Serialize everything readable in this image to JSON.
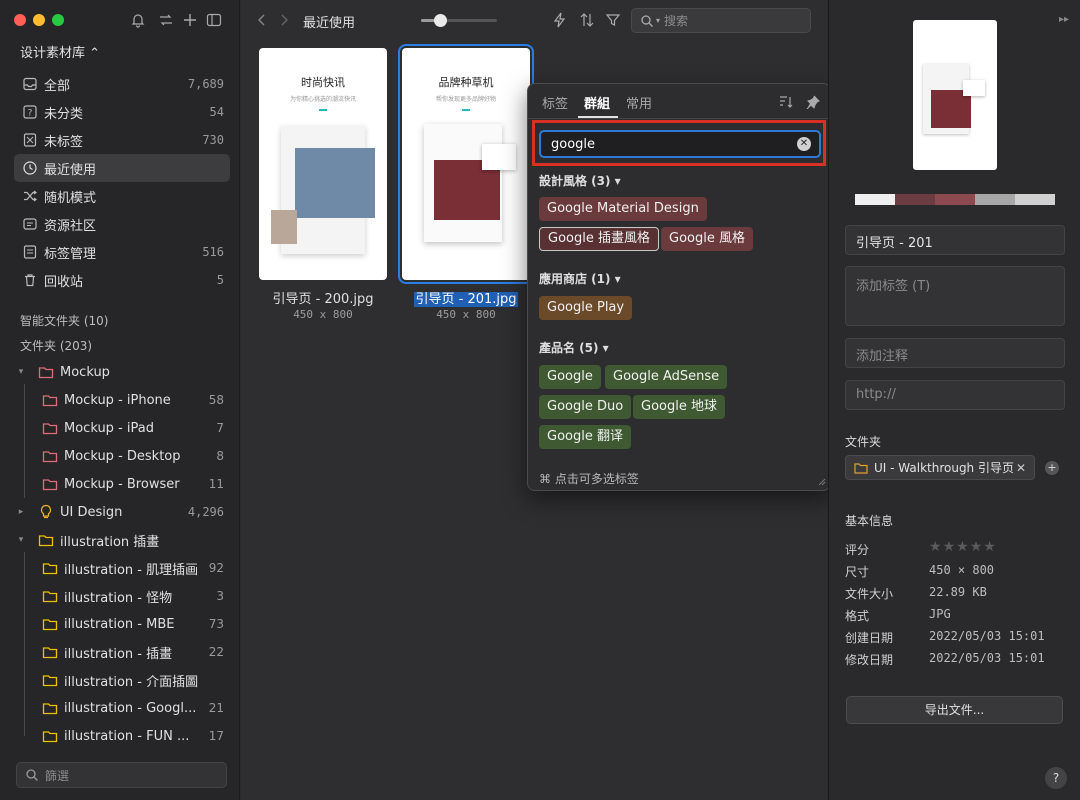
{
  "sidebar": {
    "library_title": "设计素材库 ⌃",
    "items": [
      {
        "label": "全部",
        "count": "7,689"
      },
      {
        "label": "未分类",
        "count": "54"
      },
      {
        "label": "未标签",
        "count": "730"
      },
      {
        "label": "最近使用",
        "count": ""
      },
      {
        "label": "随机模式",
        "count": ""
      },
      {
        "label": "资源社区",
        "count": ""
      },
      {
        "label": "标签管理",
        "count": "516"
      },
      {
        "label": "回收站",
        "count": "5"
      }
    ],
    "smart_folders": "智能文件夹 (10)",
    "folders_header": "文件夹 (203)",
    "folders": [
      {
        "label": "Mockup",
        "count": ""
      },
      {
        "label": "Mockup - iPhone",
        "count": "58"
      },
      {
        "label": "Mockup - iPad",
        "count": "7"
      },
      {
        "label": "Mockup - Desktop",
        "count": "8"
      },
      {
        "label": "Mockup - Browser",
        "count": "11"
      },
      {
        "label": "UI Design",
        "count": "4,296"
      },
      {
        "label": "illustration 插畫",
        "count": ""
      },
      {
        "label": "illustration - 肌理插画",
        "count": "92"
      },
      {
        "label": "illustration - 怪物",
        "count": "3"
      },
      {
        "label": "illustration - MBE",
        "count": "73"
      },
      {
        "label": "illustration - 插畫",
        "count": "22"
      },
      {
        "label": "illustration - 介面插圖",
        "count": ""
      },
      {
        "label": "illustration - Googl...",
        "count": "21"
      },
      {
        "label": "illustration - FUN ...",
        "count": "17"
      }
    ],
    "filter_placeholder": "篩選"
  },
  "toolbar": {
    "title": "最近使用",
    "zoom_level": 0.25,
    "search_placeholder": "搜索"
  },
  "grid": {
    "items": [
      {
        "name": "引导页 - 200.jpg",
        "size": "450 x 800",
        "heading": "时尚快讯",
        "sub": "为你精心挑选的潮流快讯"
      },
      {
        "name": "引导页 - 201.jpg",
        "size": "450 x 800",
        "heading": "品牌种草机",
        "sub": "帮你发现更多品牌好物"
      }
    ]
  },
  "popover": {
    "tabs": [
      "标签",
      "群組",
      "常用"
    ],
    "search_value": "google",
    "groups": [
      {
        "title": "設計風格 (3) ▾",
        "tags": [
          "Google Material Design",
          "Google 插畫風格",
          "Google 風格"
        ]
      },
      {
        "title": "應用商店 (1) ▾",
        "tags": [
          "Google Play"
        ]
      },
      {
        "title": "產品名 (5) ▾",
        "tags": [
          "Google",
          "Google AdSense",
          "Google Duo",
          "Google 地球",
          "Google 翻译"
        ]
      }
    ],
    "footer": "⌘ 点击可多选标签"
  },
  "inspector": {
    "name_value": "引导页 - 201",
    "tags_placeholder": "添加标签 (T)",
    "note_placeholder": "添加注释",
    "url_placeholder": "http://",
    "folder_label": "文件夹",
    "folder_chip": "UI - Walkthrough 引导页",
    "basic_info_label": "基本信息",
    "info": [
      {
        "key": "评分",
        "value": ""
      },
      {
        "key": "尺寸",
        "value": "450 × 800"
      },
      {
        "key": "文件大小",
        "value": "22.89 KB"
      },
      {
        "key": "格式",
        "value": "JPG"
      },
      {
        "key": "创建日期",
        "value": "2022/05/03 15:01"
      },
      {
        "key": "修改日期",
        "value": "2022/05/03 15:01"
      }
    ],
    "rating": 0,
    "export_label": "导出文件...",
    "help": "?",
    "palette": [
      "#efefef",
      "#6b3c42",
      "#8c4a50",
      "#a7a7a7",
      "#d0d0d0"
    ]
  }
}
